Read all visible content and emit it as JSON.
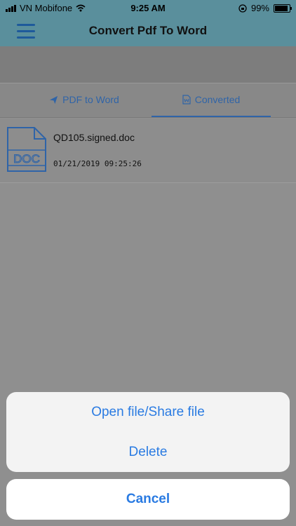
{
  "status_bar": {
    "carrier": "VN Mobifone",
    "time": "9:25 AM",
    "battery": "99%"
  },
  "navbar": {
    "title": "Convert Pdf To Word"
  },
  "tabs": [
    {
      "label": "PDF to Word"
    },
    {
      "label": "Converted"
    }
  ],
  "files": [
    {
      "name": "QD105.signed.doc",
      "date": "01/21/2019 09:25:26",
      "icon_text": "DOC"
    }
  ],
  "action_sheet": {
    "open_label": "Open file/Share file",
    "delete_label": "Delete",
    "cancel_label": "Cancel"
  },
  "colors": {
    "accent": "#2a7be2",
    "navbar": "#5a8f9c",
    "tab_text": "#2f64a8"
  }
}
